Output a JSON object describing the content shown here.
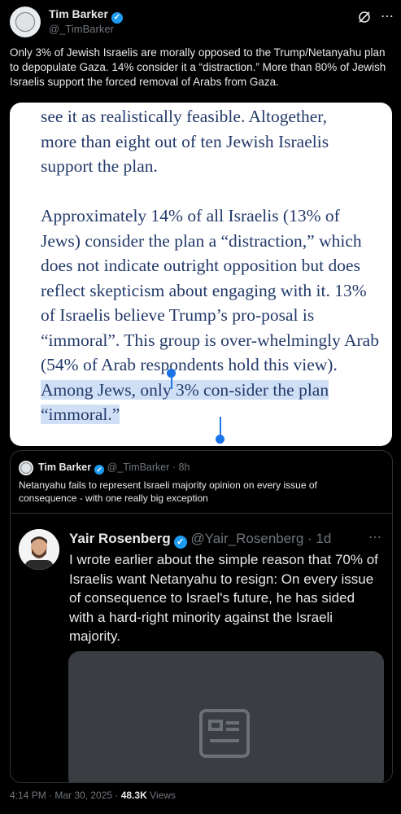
{
  "tweet": {
    "author_name": "Tim Barker",
    "author_handle": "@_TimBarker",
    "text": "Only 3% of Jewish Israelis are morally opposed to the Trump/Netanyahu plan to depopulate Gaza. 14% consider it a “distraction.” More than 80% of  Jewish Israelis support the forced removal of Arabs from Gaza."
  },
  "screenshot": {
    "para1": "see it as realistically feasible. Altogether, more than eight out of ten Jewish Israelis support the plan.",
    "para2_plain": "Approximately 14% of all Israelis (13% of Jews) consider the plan a “distraction,” which does not indicate outright opposition but does reflect skepticism about engaging with it. 13% of Israelis believe Trump’s pro-posal is “immoral”. This group is over-whelmingly Arab (54% of Arab respondents hold this view). ",
    "para2_highlight": "Among Jews, only 3% con-sider the plan “immoral.”"
  },
  "quoted": {
    "author_name": "Tim Barker",
    "author_handle": "@_TimBarker",
    "time": "8h",
    "text": "Netanyahu fails to represent Israeli majority opinion on every issue of consequence - with one really big exception",
    "nested": {
      "author_name": "Yair Rosenberg",
      "author_handle": "@Yair_Rosenberg",
      "time": "1d",
      "text": "I wrote earlier about the simple reason that 70% of Israelis want Netanyahu to resign: On every issue of consequence to Israel's future, he has sided with a hard-right minority against the Israeli majority.",
      "card_icon": "article-icon"
    }
  },
  "footer": {
    "timestamp": "4:14 PM · Mar 30, 2025 · ",
    "views_count": "48.3K",
    "views_label": " Views"
  },
  "colors": {
    "verified": "#1d9bf0",
    "highlight": "#cfe0f6",
    "doc_text": "#233a6a"
  }
}
